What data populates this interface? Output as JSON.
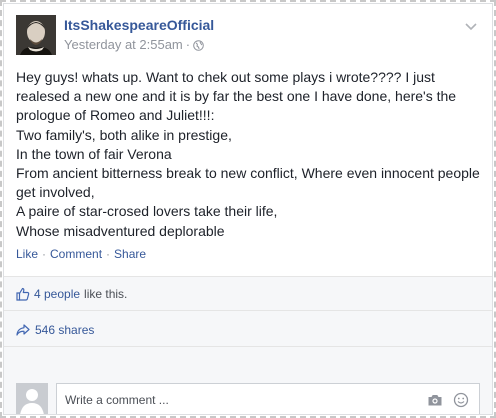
{
  "post": {
    "author": "ItsShakespeareOfficial",
    "timestamp": "Yesterday at 2:55am",
    "meta_separator": "·",
    "privacy_icon": "globe-icon",
    "body": "Hey guys! whats up. Want to chek out some plays i wrote???? I just realesed a new one and it is by far the best one I have done, here's the prologue of Romeo and Juliet!!!:\nTwo family's, both alike in prestige,\nIn the town of fair Verona\nFrom ancient bitterness break to new conflict, Where even innocent people get involved,\nA paire of star-crosed lovers take their life,\nWhose misadventured deplorable"
  },
  "actions": {
    "like": "Like",
    "comment": "Comment",
    "share": "Share",
    "separator": "·"
  },
  "likes": {
    "icon": "thumbs-up-icon",
    "people": "4 people",
    "rest": "like this."
  },
  "shares": {
    "icon": "share-arrow-icon",
    "text": "546 shares"
  },
  "comment_box": {
    "placeholder": "Write a comment ...",
    "camera_icon": "camera-icon",
    "emoji_icon": "emoji-icon"
  },
  "colors": {
    "link": "#365899",
    "meta": "#90949c",
    "strip_bg": "#f6f7f9"
  }
}
